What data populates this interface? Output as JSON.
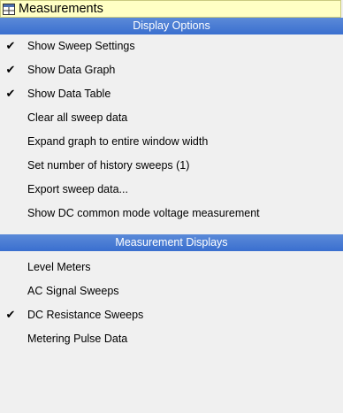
{
  "menu": {
    "title": "Measurements",
    "display_options": {
      "header": "Display Options",
      "items": [
        {
          "label": "Show Sweep Settings",
          "checked": true
        },
        {
          "label": "Show Data Graph",
          "checked": true
        },
        {
          "label": "Show Data Table",
          "checked": true
        },
        {
          "label": "Clear all sweep data",
          "checked": false
        },
        {
          "label": "Expand graph to entire window width",
          "checked": false
        },
        {
          "label": "Set number of history sweeps (1)",
          "checked": false
        },
        {
          "label": "Export sweep data...",
          "checked": false
        },
        {
          "label": "Show DC common mode voltage measurement",
          "checked": false
        }
      ]
    },
    "measurement_displays": {
      "header": "Measurement Displays",
      "items": [
        {
          "label": "Level Meters",
          "checked": false
        },
        {
          "label": "AC Signal Sweeps",
          "checked": false
        },
        {
          "label": "DC Resistance Sweeps",
          "checked": true
        },
        {
          "label": "Metering Pulse Data",
          "checked": false
        }
      ]
    },
    "check_glyph": "✔"
  }
}
